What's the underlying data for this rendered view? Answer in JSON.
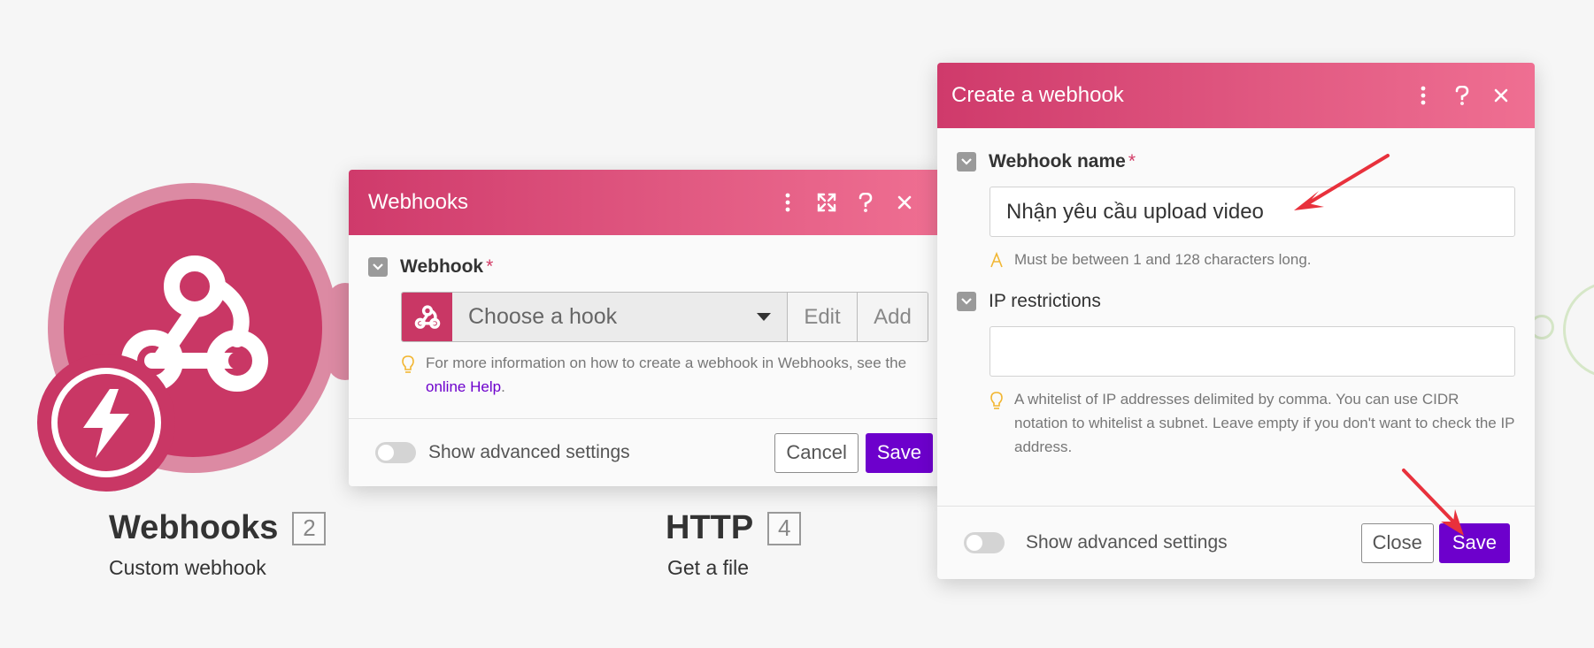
{
  "colors": {
    "brand": "#c93765",
    "accent": "#6d00cc",
    "annotation_arrow": "#e8313c"
  },
  "canvas": {
    "webhooks_module": {
      "title": "Webhooks",
      "count": "2",
      "subtitle": "Custom webhook",
      "icon": "webhook-icon",
      "badge_icon": "lightning-icon"
    },
    "http_module": {
      "title": "HTTP",
      "count": "4",
      "subtitle": "Get a file"
    }
  },
  "webhooks_dialog": {
    "title": "Webhooks",
    "controls": [
      "more-icon",
      "expand-icon",
      "help-icon",
      "close-icon"
    ],
    "field_label": "Webhook",
    "required_mark": "*",
    "select_placeholder": "Choose a hook",
    "edit_label": "Edit",
    "add_label": "Add",
    "hint_prefix": "For more information on how to create a webhook in Webhooks, see the ",
    "hint_link": "online Help",
    "hint_suffix": ".",
    "advanced_label": "Show advanced settings",
    "cancel_label": "Cancel",
    "save_label": "Save"
  },
  "create_dialog": {
    "title": "Create a webhook",
    "controls": [
      "more-icon",
      "help-icon",
      "close-icon"
    ],
    "name_label": "Webhook name",
    "required_mark": "*",
    "name_value": "Nhận yêu cầu upload video",
    "name_hint": "Must be between 1 and 128 characters long.",
    "ip_label": "IP restrictions",
    "ip_value": "",
    "ip_hint": "A whitelist of IP addresses delimited by comma. You can use CIDR notation to whitelist a subnet. Leave empty if you don't want to check the IP address.",
    "advanced_label": "Show advanced settings",
    "close_label": "Close",
    "save_label": "Save"
  }
}
